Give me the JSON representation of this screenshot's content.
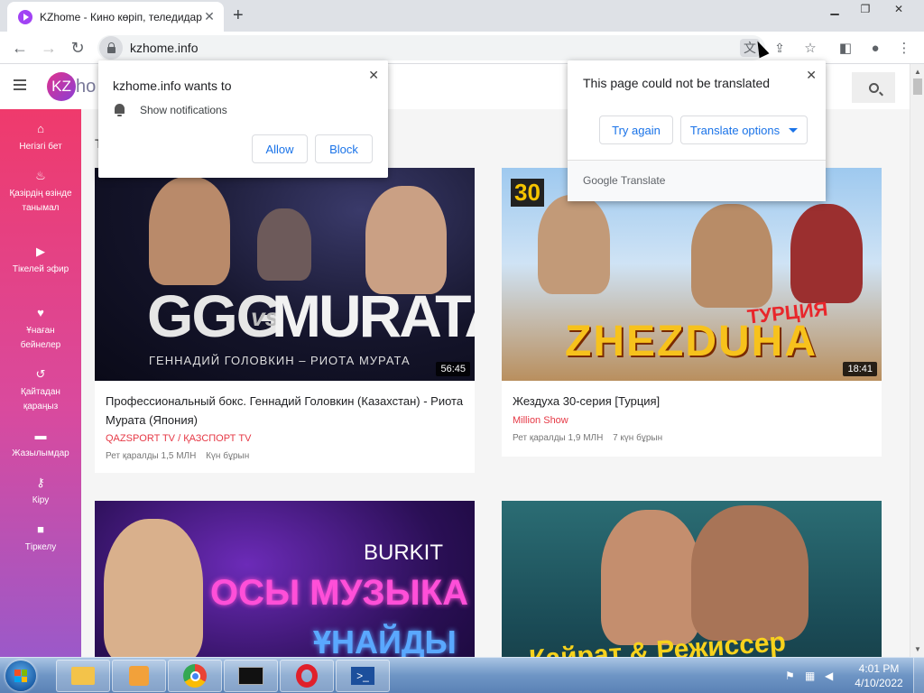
{
  "browser": {
    "tab_title": "KZhome - Кино көріп, теледидар",
    "url": "kzhome.info",
    "window_controls": [
      "minimize",
      "restore",
      "close"
    ]
  },
  "site": {
    "logo_text": "KZ",
    "logo_suffix": "ho",
    "sidebar": [
      {
        "icon": "home-icon",
        "glyph": "⌂",
        "label": "Негізгі бет"
      },
      {
        "icon": "fire-icon",
        "glyph": "♨",
        "label": "Қазірдің өзінде танымал"
      },
      {
        "icon": "youtube-icon",
        "glyph": "▶",
        "label": "Тікелей эфир"
      },
      {
        "icon": "heart-icon",
        "glyph": "♥",
        "label": "Ұнаған бейнелер"
      },
      {
        "icon": "history-icon",
        "glyph": "↺",
        "label": "Қайтадан қараңыз"
      },
      {
        "icon": "folder-icon",
        "glyph": "▬",
        "label": "Жазылымдар"
      },
      {
        "icon": "key-icon",
        "glyph": "⚷",
        "label": "Кіру"
      },
      {
        "icon": "lock-icon",
        "glyph": "■",
        "label": "Тіркелу"
      }
    ],
    "feed_title_partial": "Т"
  },
  "videos": [
    {
      "title": "Профессиональный бокс. Геннадий Головкин (Казахстан) - Риота Мурата (Япония)",
      "channel": "QAZSPORT TV / ҚАЗСПОРТ TV",
      "views": "Рет қаралды 1,5 МЛН",
      "age": "Күн бұрын",
      "duration": "56:45",
      "thumb_text": "GGG",
      "thumb_vs": "vs",
      "thumb_text2": "MURATA",
      "thumb_caption": "ГЕННАДИЙ ГОЛОВКИН – РИОТА МУРАТА"
    },
    {
      "title": "Жездуха 30-серия [Турция]",
      "channel": "Million Show",
      "views": "Рет қаралды 1,9 МЛН",
      "age": "7 күн бұрын",
      "duration": "18:41",
      "thumb_badge": "30",
      "thumb_text": "ZHEZDUHA",
      "thumb_sub": "ТУРЦИЯ"
    },
    {
      "thumb_text": "BURKIT",
      "thumb_line1": "ОСЫ МУЗЫКА",
      "thumb_line2": "ҰНАЙДЫ"
    },
    {
      "thumb_text": "Қайрат & Режиссер"
    }
  ],
  "notification_popup": {
    "title": "kzhome.info wants to",
    "permission": "Show notifications",
    "allow": "Allow",
    "block": "Block",
    "close": "✕"
  },
  "translate_popup": {
    "title": "This page could not be translated",
    "try_again": "Try again",
    "options": "Translate options",
    "brand": "Google",
    "brand_suffix": "Translate",
    "close": "✕"
  },
  "taskbar": {
    "time": "4:01 PM",
    "date": "4/10/2022",
    "apps": [
      "file-explorer",
      "media-player",
      "chrome",
      "command-prompt",
      "opera",
      "powershell"
    ]
  },
  "colors": {
    "sidebar_top": "#ef3a6c",
    "sidebar_bottom": "#9b59c9",
    "channel_red": "#e63946",
    "link_blue": "#1a73e8"
  }
}
